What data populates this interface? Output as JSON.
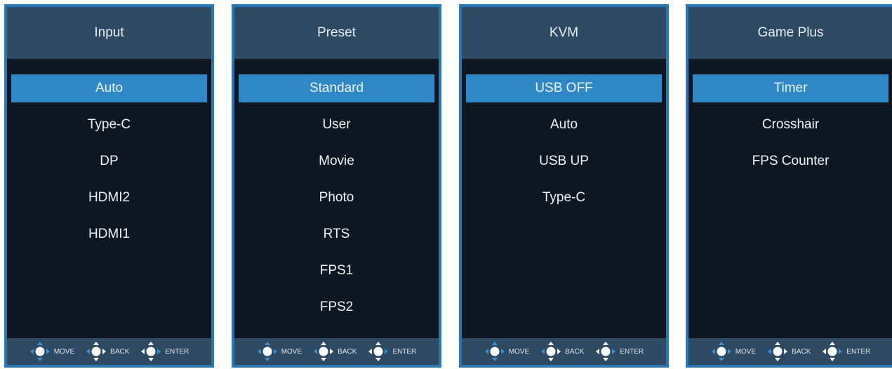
{
  "panels": [
    {
      "title": "Input",
      "items": [
        "Auto",
        "Type-C",
        "DP",
        "HDMI2",
        "HDMI1"
      ],
      "selected_index": 0
    },
    {
      "title": "Preset",
      "items": [
        "Standard",
        "User",
        "Movie",
        "Photo",
        "RTS",
        "FPS1",
        "FPS2"
      ],
      "selected_index": 0
    },
    {
      "title": "KVM",
      "items": [
        "USB OFF",
        "Auto",
        "USB UP",
        "Type-C"
      ],
      "selected_index": 0
    },
    {
      "title": "Game Plus",
      "items": [
        "Timer",
        "Crosshair",
        "FPS Counter"
      ],
      "selected_index": 0
    }
  ],
  "footer": {
    "move_label": "MOVE",
    "back_label": "BACK",
    "enter_label": "ENTER",
    "move_icon": "dpad-move-icon",
    "back_icon": "dpad-back-icon",
    "enter_icon": "dpad-enter-icon"
  },
  "colors": {
    "frame": "#2a77b8",
    "header": "#2e4a63",
    "body": "#0e1621",
    "selected": "#2f87c6"
  }
}
